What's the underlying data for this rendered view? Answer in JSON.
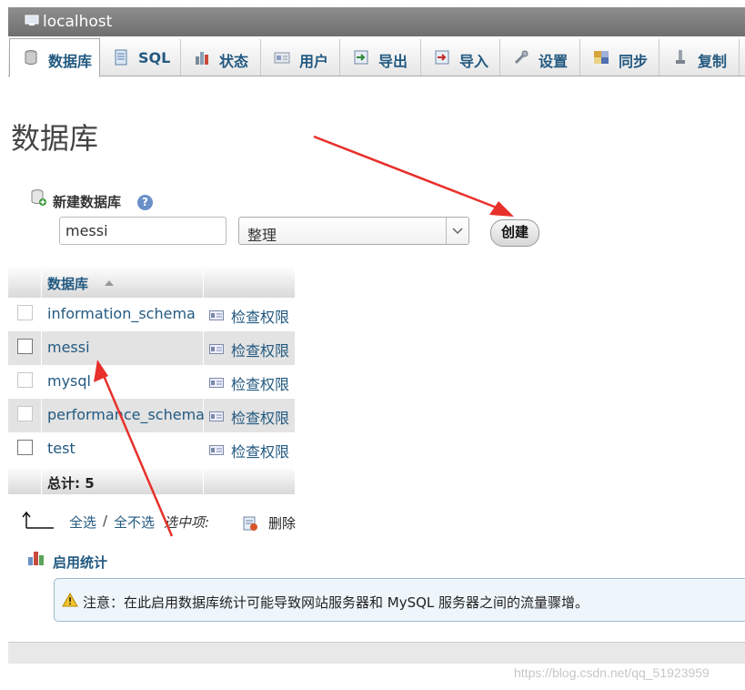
{
  "server": {
    "title": "localhost"
  },
  "tabs": [
    {
      "label": "数据库",
      "icon": "database-icon",
      "active": true
    },
    {
      "label": "SQL",
      "icon": "sql-icon"
    },
    {
      "label": "状态",
      "icon": "status-icon"
    },
    {
      "label": "用户",
      "icon": "users-icon"
    },
    {
      "label": "导出",
      "icon": "export-icon"
    },
    {
      "label": "导入",
      "icon": "import-icon"
    },
    {
      "label": "设置",
      "icon": "settings-wrench-icon"
    },
    {
      "label": "同步",
      "icon": "sync-icon"
    },
    {
      "label": "复制",
      "icon": "replication-icon"
    }
  ],
  "page": {
    "title": "数据库"
  },
  "create_db": {
    "label": "新建数据库",
    "name_value": "messi",
    "collation_value": "整理",
    "button_label": "创建"
  },
  "db_table": {
    "header": "数据库",
    "rows": [
      {
        "name": "information_schema",
        "priv": "检查权限"
      },
      {
        "name": "messi",
        "priv": "检查权限"
      },
      {
        "name": "mysql",
        "priv": "检查权限"
      },
      {
        "name": "performance_schema",
        "priv": "检查权限"
      },
      {
        "name": "test",
        "priv": "检查权限"
      }
    ],
    "total": "总计: 5"
  },
  "bulk": {
    "check_all": "全选",
    "separator": "/",
    "uncheck_all": "全不选",
    "with_selected": "选中项:",
    "delete": "删除"
  },
  "stats": {
    "link": "启用统计",
    "notice": "注意：在此启用数据库统计可能导致网站服务器和 MySQL 服务器之间的流量骤增。"
  },
  "watermark": "https://blog.csdn.net/qq_51923959",
  "colors": {
    "link": "#235a81",
    "annotation_arrow": "#e8302a",
    "titlebar": "#7a7a7a"
  }
}
